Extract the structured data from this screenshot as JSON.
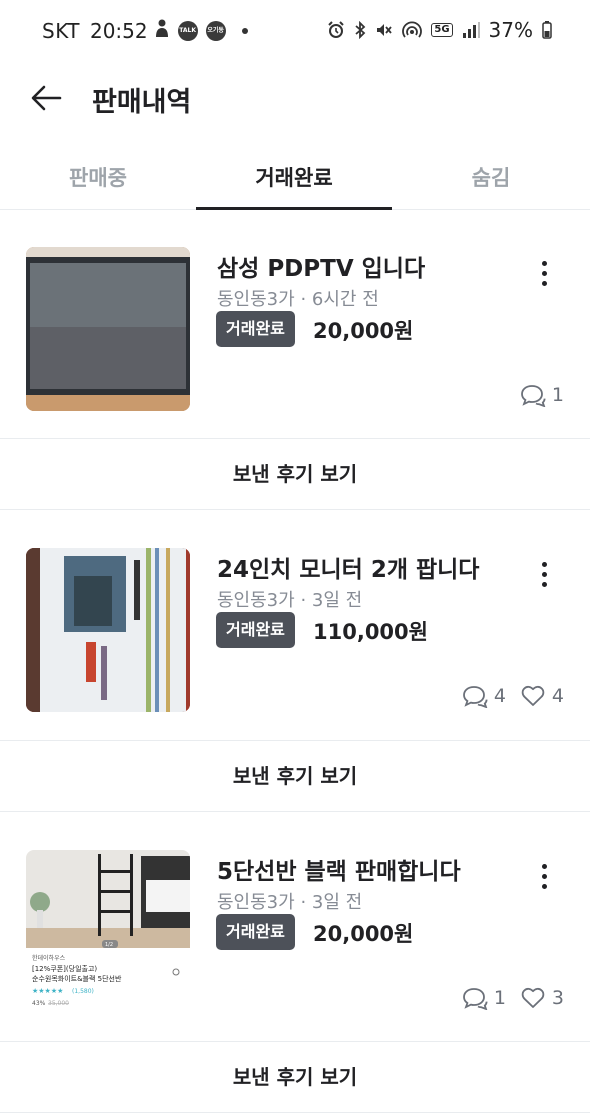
{
  "status_bar": {
    "carrier": "SKT",
    "time": "20:52",
    "talk_badge": "TALK",
    "app_badge": "오기동",
    "network": "5G",
    "battery": "37%"
  },
  "header": {
    "title": "판매내역"
  },
  "tabs": [
    {
      "label": "판매중"
    },
    {
      "label": "거래완료"
    },
    {
      "label": "숨김"
    }
  ],
  "items": [
    {
      "title": "삼성 PDPTV 입니다",
      "location": "동인동3가",
      "time": "6시간 전",
      "status": "거래완료",
      "price": "20,000원",
      "chats": "1",
      "likes": "",
      "thumb_icon": "tv-photo"
    },
    {
      "title": "24인치 모니터 2개 팝니다",
      "location": "동인동3가",
      "time": "3일 전",
      "status": "거래완료",
      "price": "110,000원",
      "chats": "4",
      "likes": "4",
      "thumb_icon": "monitor-box-photo"
    },
    {
      "title": "5단선반 블랙 판매합니다",
      "location": "동인동3가",
      "time": "3일 전",
      "status": "거래완료",
      "price": "20,000원",
      "chats": "1",
      "likes": "3",
      "thumb_icon": "shelf-product-screenshot",
      "thumb_text": {
        "shop": "한데이하우스",
        "line1": "[12%쿠폰](당일출고)",
        "line2": "순수원목화이트&블랙 5단선반",
        "pager": "1/2",
        "rating": "(1,580)",
        "discount": "43%",
        "orig_price": "35,000"
      }
    }
  ],
  "review_label": "보낸 후기 보기",
  "meta_separator": "·",
  "colors": {
    "badge_bg": "#4d5159",
    "text_primary": "#212124",
    "text_secondary": "#868b94",
    "tab_inactive": "#9ea4aa"
  }
}
